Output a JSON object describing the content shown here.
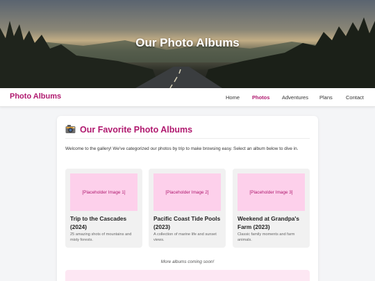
{
  "hero": {
    "title": "Our Photo Albums"
  },
  "nav": {
    "brand": "Photo Albums",
    "items": [
      {
        "label": "Home"
      },
      {
        "label": "Photos"
      },
      {
        "label": "Adventures"
      },
      {
        "label": "Plans"
      },
      {
        "label": "Contact"
      }
    ],
    "active": "Photos"
  },
  "main": {
    "heading_icon": "camera-icon",
    "heading": "Our Favorite Photo Albums",
    "intro": "Welcome to the gallery! We've categorized our photos by trip to make browsing easy. Select an album below to dive in.",
    "albums": [
      {
        "placeholder": "[Placeholder Image 1]",
        "title": "Trip to the Cascades (2024)",
        "description": "25 amazing shots of mountains and misty forests."
      },
      {
        "placeholder": "[Placeholder Image 2]",
        "title": "Pacific Coast Tide Pools (2023)",
        "description": "A collection of marine life and sunset views."
      },
      {
        "placeholder": "[Placeholder Image 3]",
        "title": "Weekend at Grandpa's Farm (2023)",
        "description": "Classic family moments and farm animals."
      }
    ],
    "coming_soon": "More albums coming soon!"
  },
  "colors": {
    "brand": "#b0196f",
    "placeholder_bg": "#fdd0eb",
    "page_bg": "#f4f5f7"
  }
}
